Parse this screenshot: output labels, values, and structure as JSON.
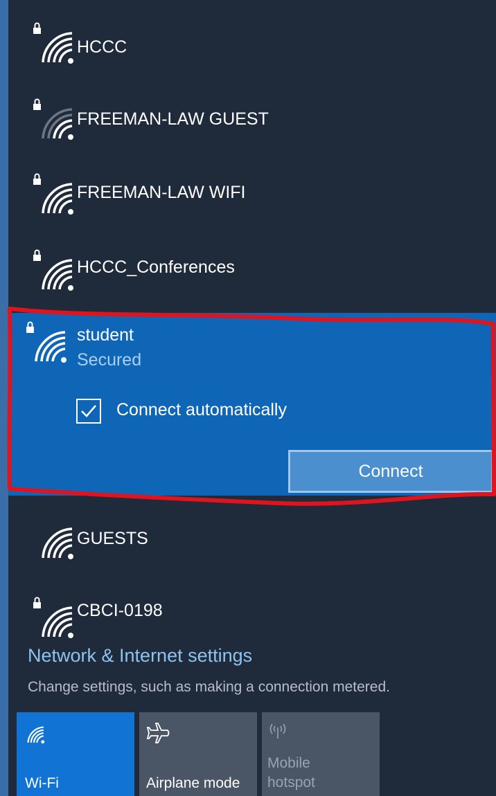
{
  "networks": [
    {
      "name": "HCCC",
      "secured": true
    },
    {
      "name": "FREEMAN-LAW GUEST",
      "secured": true
    },
    {
      "name": "FREEMAN-LAW WIFI",
      "secured": true
    },
    {
      "name": "HCCC_Conferences",
      "secured": true
    },
    {
      "name": "GUESTS",
      "secured": false
    },
    {
      "name": "CBCI-0198",
      "secured": true
    }
  ],
  "selected_network": {
    "name": "student",
    "status": "Secured",
    "connect_automatically_label": "Connect automatically",
    "connect_automatically_checked": true,
    "connect_button": "Connect"
  },
  "settings": {
    "link": "Network & Internet settings",
    "description": "Change settings, such as making a connection metered."
  },
  "quick_actions": {
    "wifi": "Wi-Fi",
    "airplane": "Airplane mode",
    "hotspot_line1": "Mobile",
    "hotspot_line2": "hotspot"
  },
  "colors": {
    "panel_background": "#1f2a3a",
    "selected_background": "#0f66b7",
    "accent_link": "#8ec3f0",
    "wifi_tile_active": "#1174d4",
    "tile_inactive": "#4a5566",
    "annotation_red": "#e0141e"
  },
  "icons": {
    "network": "wifi-signal-icon",
    "secured_network": "wifi-lock-icon",
    "checkbox": "checkmark-icon",
    "airplane": "airplane-icon",
    "hotspot": "hotspot-icon"
  }
}
